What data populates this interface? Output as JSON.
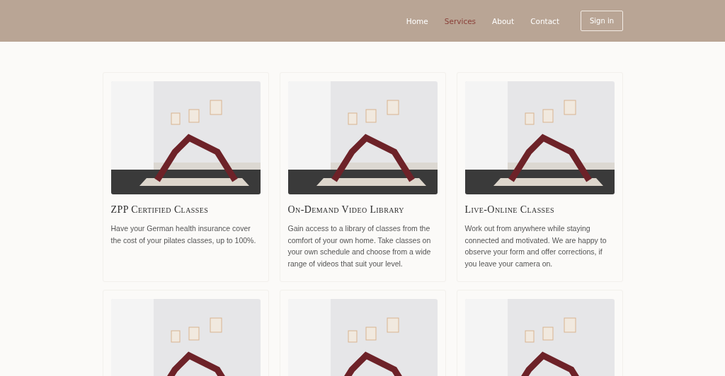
{
  "nav": {
    "items": [
      {
        "label": "Home",
        "selected": false
      },
      {
        "label": "Services",
        "selected": true
      },
      {
        "label": "About",
        "selected": false
      },
      {
        "label": "Contact",
        "selected": false
      }
    ],
    "button": "Sign in"
  },
  "cards": [
    {
      "kind": "service",
      "title": "ZPP Certified Classes",
      "description": "Have your German health insurance cover the cost of your pilates classes, up to 100%."
    },
    {
      "kind": "service",
      "title": "On-Demand Video Library",
      "description": "Gain access to a library of classes from the comfort of your own home. Take classes on your own schedule and choose from a wide range of videos that suit your level."
    },
    {
      "kind": "service",
      "title": "Live-Online Classes",
      "description": "Work out from anywhere while staying connected and motivated. We are happy to observe your form and offer corrections, if you leave your camera on."
    },
    {
      "kind": "photo-only"
    },
    {
      "kind": "photo-only"
    },
    {
      "kind": "photo-only"
    }
  ]
}
